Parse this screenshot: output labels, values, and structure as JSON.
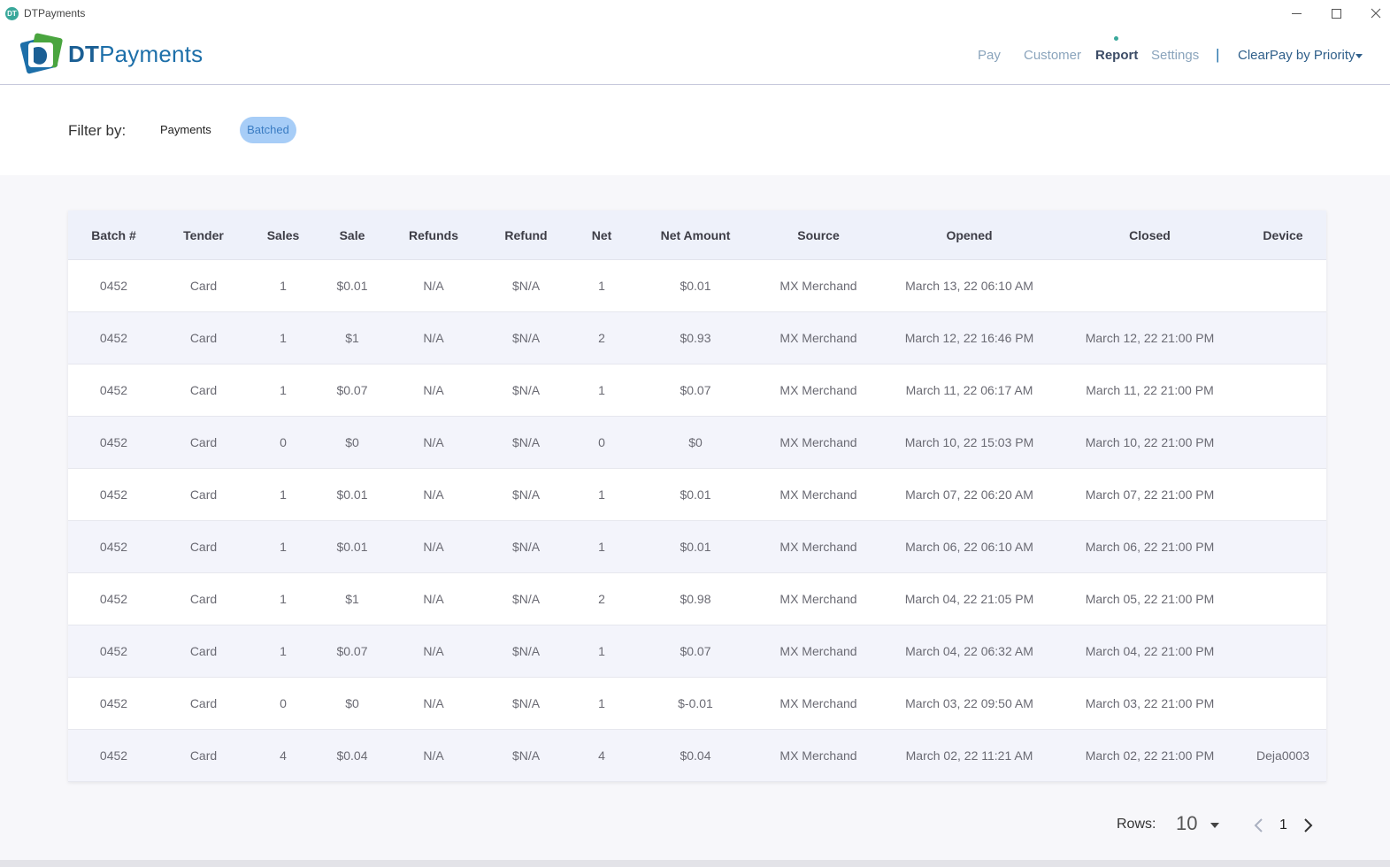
{
  "window": {
    "icon_text": "DT",
    "title": "DTPayments"
  },
  "header": {
    "logo_bold": "DT",
    "logo_rest": "Payments",
    "nav": {
      "pay": "Pay",
      "customer": "Customer",
      "report": "Report",
      "settings": "Settings"
    },
    "separator": "|",
    "merchant": "ClearPay by Priority"
  },
  "filter": {
    "label": "Filter by:",
    "payments": "Payments",
    "batched": "Batched"
  },
  "table": {
    "columns": [
      "Batch #",
      "Tender",
      "Sales",
      "Sale",
      "Refunds",
      "Refund",
      "Net",
      "Net Amount",
      "Source",
      "Opened",
      "Closed",
      "Device"
    ],
    "rows": [
      [
        "0452",
        "Card",
        "1",
        "$0.01",
        "N/A",
        "$N/A",
        "1",
        "$0.01",
        "MX Merchand",
        "March 13, 22 06:10 AM",
        "",
        ""
      ],
      [
        "0452",
        "Card",
        "1",
        "$1",
        "N/A",
        "$N/A",
        "2",
        "$0.93",
        "MX Merchand",
        "March 12, 22 16:46 PM",
        "March 12, 22 21:00 PM",
        ""
      ],
      [
        "0452",
        "Card",
        "1",
        "$0.07",
        "N/A",
        "$N/A",
        "1",
        "$0.07",
        "MX Merchand",
        "March 11, 22 06:17 AM",
        "March 11, 22 21:00 PM",
        ""
      ],
      [
        "0452",
        "Card",
        "0",
        "$0",
        "N/A",
        "$N/A",
        "0",
        "$0",
        "MX Merchand",
        "March 10, 22 15:03 PM",
        "March 10, 22 21:00 PM",
        ""
      ],
      [
        "0452",
        "Card",
        "1",
        "$0.01",
        "N/A",
        "$N/A",
        "1",
        "$0.01",
        "MX Merchand",
        "March 07, 22 06:20 AM",
        "March 07, 22 21:00 PM",
        ""
      ],
      [
        "0452",
        "Card",
        "1",
        "$0.01",
        "N/A",
        "$N/A",
        "1",
        "$0.01",
        "MX Merchand",
        "March 06, 22 06:10 AM",
        "March 06, 22 21:00 PM",
        ""
      ],
      [
        "0452",
        "Card",
        "1",
        "$1",
        "N/A",
        "$N/A",
        "2",
        "$0.98",
        "MX Merchand",
        "March 04, 22 21:05 PM",
        "March 05, 22 21:00 PM",
        ""
      ],
      [
        "0452",
        "Card",
        "1",
        "$0.07",
        "N/A",
        "$N/A",
        "1",
        "$0.07",
        "MX Merchand",
        "March 04, 22 06:32 AM",
        "March 04, 22 21:00 PM",
        ""
      ],
      [
        "0452",
        "Card",
        "0",
        "$0",
        "N/A",
        "$N/A",
        "1",
        "$-0.01",
        "MX Merchand",
        "March 03, 22 09:50 AM",
        "March 03, 22 21:00 PM",
        ""
      ],
      [
        "0452",
        "Card",
        "4",
        "$0.04",
        "N/A",
        "$N/A",
        "4",
        "$0.04",
        "MX Merchand",
        "March 02, 22 11:21 AM",
        "March 02, 22 21:00 PM",
        "Deja0003"
      ]
    ]
  },
  "pagination": {
    "rows_label": "Rows:",
    "rows_value": "10",
    "page": "1"
  },
  "colors": {
    "accent": "#1d6fa9",
    "active_dot": "#3aa89b",
    "batched_bg": "#a7cdf7",
    "header_row_bg": "#eef1fa"
  },
  "icons": {
    "app": "dt-app-icon",
    "minimize": "minimize-icon",
    "maximize": "maximize-icon",
    "close": "close-icon",
    "merchant_dropdown": "caret-down-icon",
    "rows_dropdown": "caret-down-icon",
    "prev": "chevron-left-icon",
    "next": "chevron-right-icon"
  }
}
